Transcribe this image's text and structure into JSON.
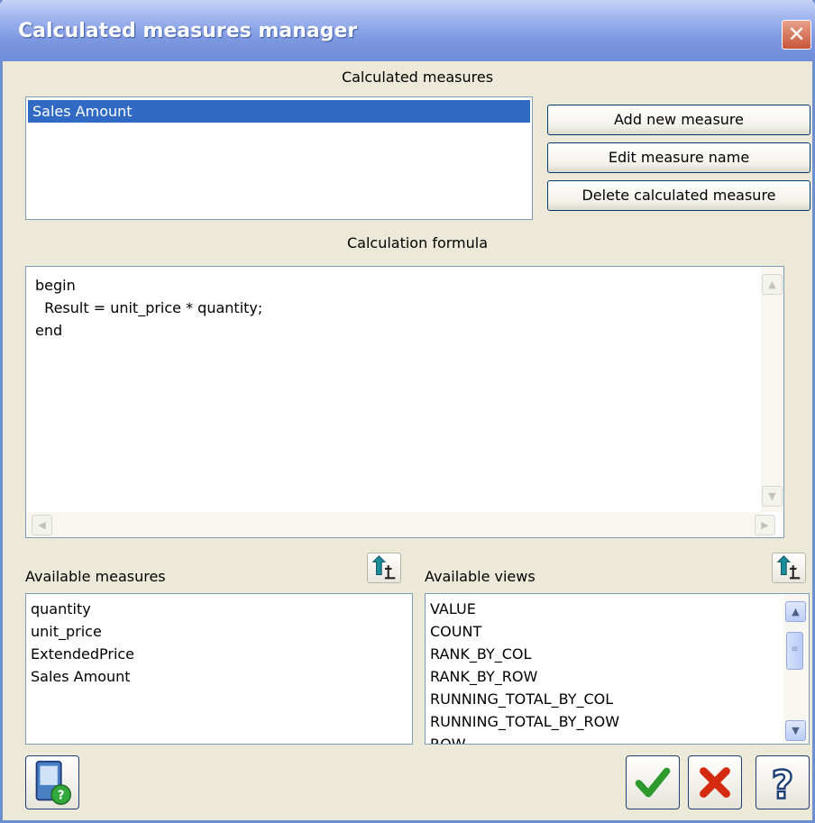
{
  "window": {
    "title": "Calculated measures manager",
    "close_glyph": "✕"
  },
  "calc_measures": {
    "label": "Calculated measures",
    "items": [
      "Sales Amount"
    ],
    "selected_index": 0
  },
  "buttons": {
    "add": "Add new measure",
    "edit": "Edit measure name",
    "delete": "Delete calculated measure"
  },
  "formula": {
    "label": "Calculation formula",
    "text": "begin\n  Result = unit_price * quantity;\nend"
  },
  "available_measures": {
    "label": "Available measures",
    "items": [
      "quantity",
      "unit_price",
      "ExtendedPrice",
      "Sales Amount"
    ]
  },
  "available_views": {
    "label": "Available views",
    "items": [
      "VALUE",
      "COUNT",
      "RANK_BY_COL",
      "RANK_BY_ROW",
      "RUNNING_TOTAL_BY_COL",
      "RUNNING_TOTAL_BY_ROW",
      "ROW"
    ]
  },
  "icons": {
    "insert": "insert-arrow-icon",
    "help_device": "device-help-icon",
    "ok": "checkmark-icon",
    "cancel": "x-mark-icon",
    "help": "question-mark-icon"
  },
  "colors": {
    "title_bar": "#7d97e0",
    "selection": "#316ac5",
    "dialog_bg": "#ece9d8",
    "ok_green": "#2e9a2e",
    "cancel_red": "#d42a0f",
    "help_blue": "#1f3e75"
  }
}
